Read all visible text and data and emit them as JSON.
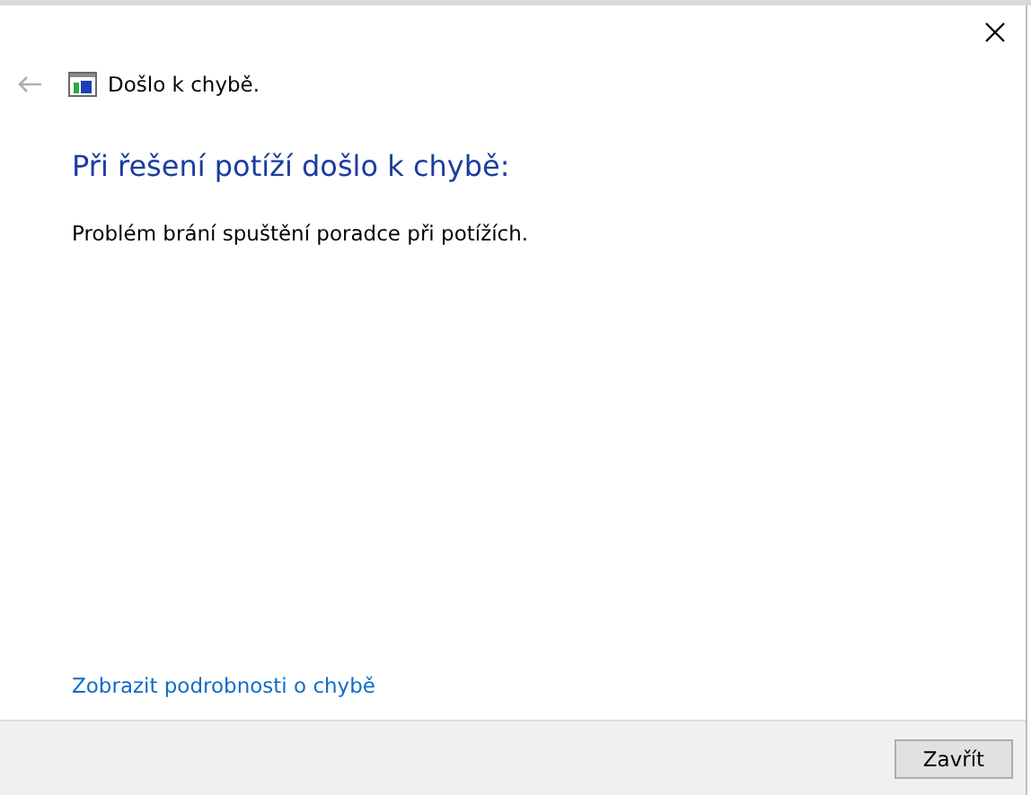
{
  "window": {
    "title": "Došlo k chybě."
  },
  "heading": "Při řešení potíží došlo k chybě:",
  "message": "Problém brání spuštění poradce při potížích.",
  "details_link": "Zobrazit podrobnosti o chybě",
  "buttons": [
    {
      "label": "Zavřít"
    }
  ]
}
